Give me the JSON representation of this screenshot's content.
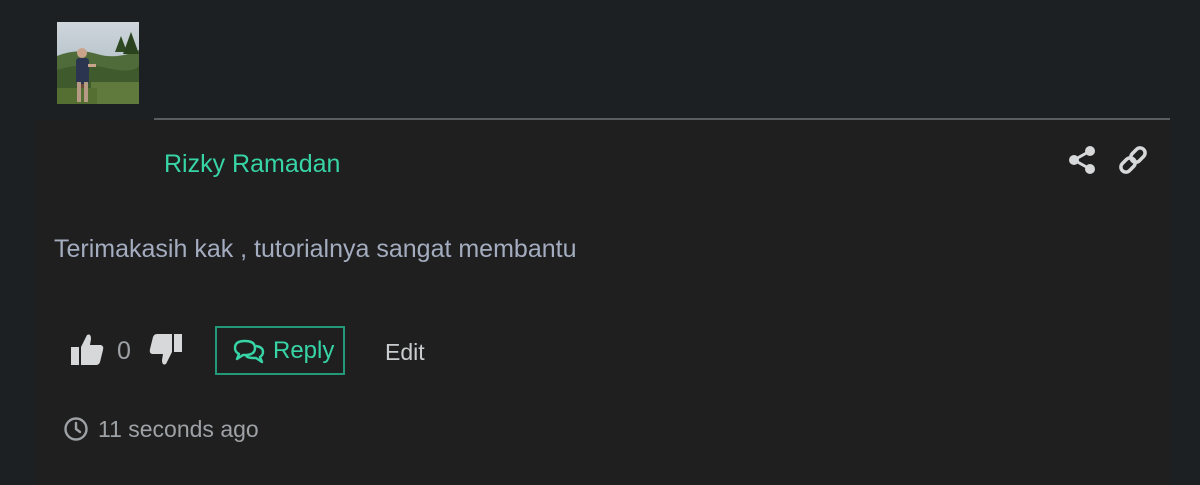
{
  "comment": {
    "author": "Rizky Ramadan",
    "text": "Terimakasih kak , tutorialnya sangat membantu",
    "vote_count": "0",
    "reply_label": "Reply",
    "edit_label": "Edit",
    "timestamp": "11 seconds ago"
  },
  "icons": {
    "share": "share-icon",
    "link": "link-icon",
    "like": "thumbs-up-icon",
    "dislike": "thumbs-down-icon",
    "reply": "chat-bubbles-icon",
    "time": "clock-icon"
  },
  "colors": {
    "background": "#1d2023",
    "card": "#1f1f1f",
    "accent": "#37d4a6",
    "reply_border": "#23997a",
    "body_text": "#a4acc0",
    "muted_text": "#9ea2a6"
  }
}
